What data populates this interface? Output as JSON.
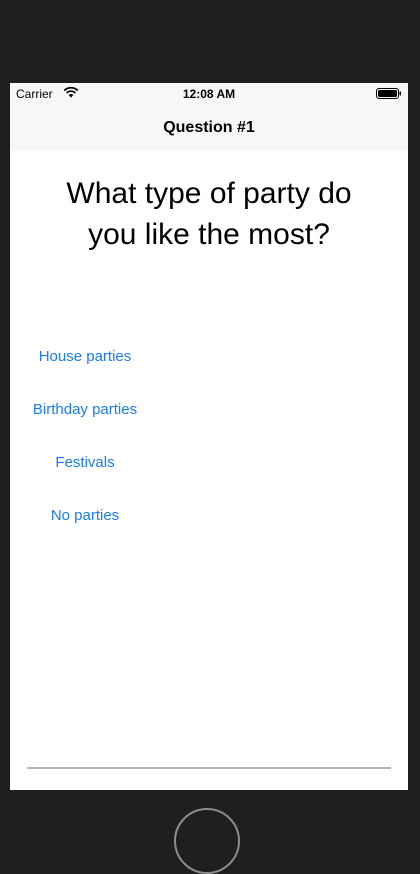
{
  "status_bar": {
    "carrier": "Carrier",
    "time": "12:08 AM",
    "wifi_icon": "wifi-icon",
    "battery_icon": "battery-icon"
  },
  "nav": {
    "title": "Question #1"
  },
  "question": {
    "line1": "What type of party do",
    "line2": "you like the most?"
  },
  "answers": [
    {
      "label": "House parties"
    },
    {
      "label": "Birthday parties"
    },
    {
      "label": "Festivals"
    },
    {
      "label": "No parties"
    }
  ],
  "colors": {
    "accent": "#1a7cf0",
    "bezel": "#1f1f1f",
    "bar": "#f7f7f7"
  }
}
